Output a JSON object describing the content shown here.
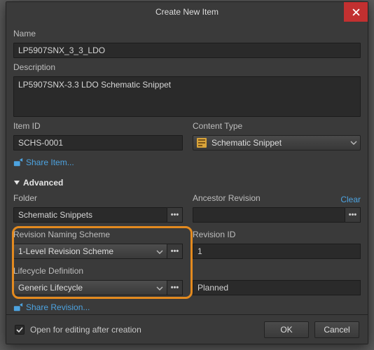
{
  "title": "Create New Item",
  "fields": {
    "name_label": "Name",
    "name_value": "LP5907SNX_3_3_LDO",
    "description_label": "Description",
    "description_value": "LP5907SNX-3.3 LDO Schematic Snippet",
    "item_id_label": "Item ID",
    "item_id_value": "SCHS-0001",
    "content_type_label": "Content Type",
    "content_type_value": "Schematic Snippet"
  },
  "share_item": "Share Item...",
  "advanced_label": "Advanced",
  "advanced": {
    "folder_label": "Folder",
    "folder_value": "Schematic Snippets",
    "ancestor_label": "Ancestor Revision",
    "ancestor_value": "",
    "clear": "Clear",
    "rev_scheme_label": "Revision Naming Scheme",
    "rev_scheme_value": "1-Level Revision Scheme",
    "rev_id_label": "Revision ID",
    "rev_id_value": "1",
    "lifecycle_label": "Lifecycle Definition",
    "lifecycle_value": "Generic Lifecycle",
    "lifecycle_state": "Planned"
  },
  "share_revision": "Share Revision...",
  "footer": {
    "open_after": "Open for editing after creation",
    "open_after_checked": true,
    "ok": "OK",
    "cancel": "Cancel"
  },
  "ellipsis": "•••"
}
